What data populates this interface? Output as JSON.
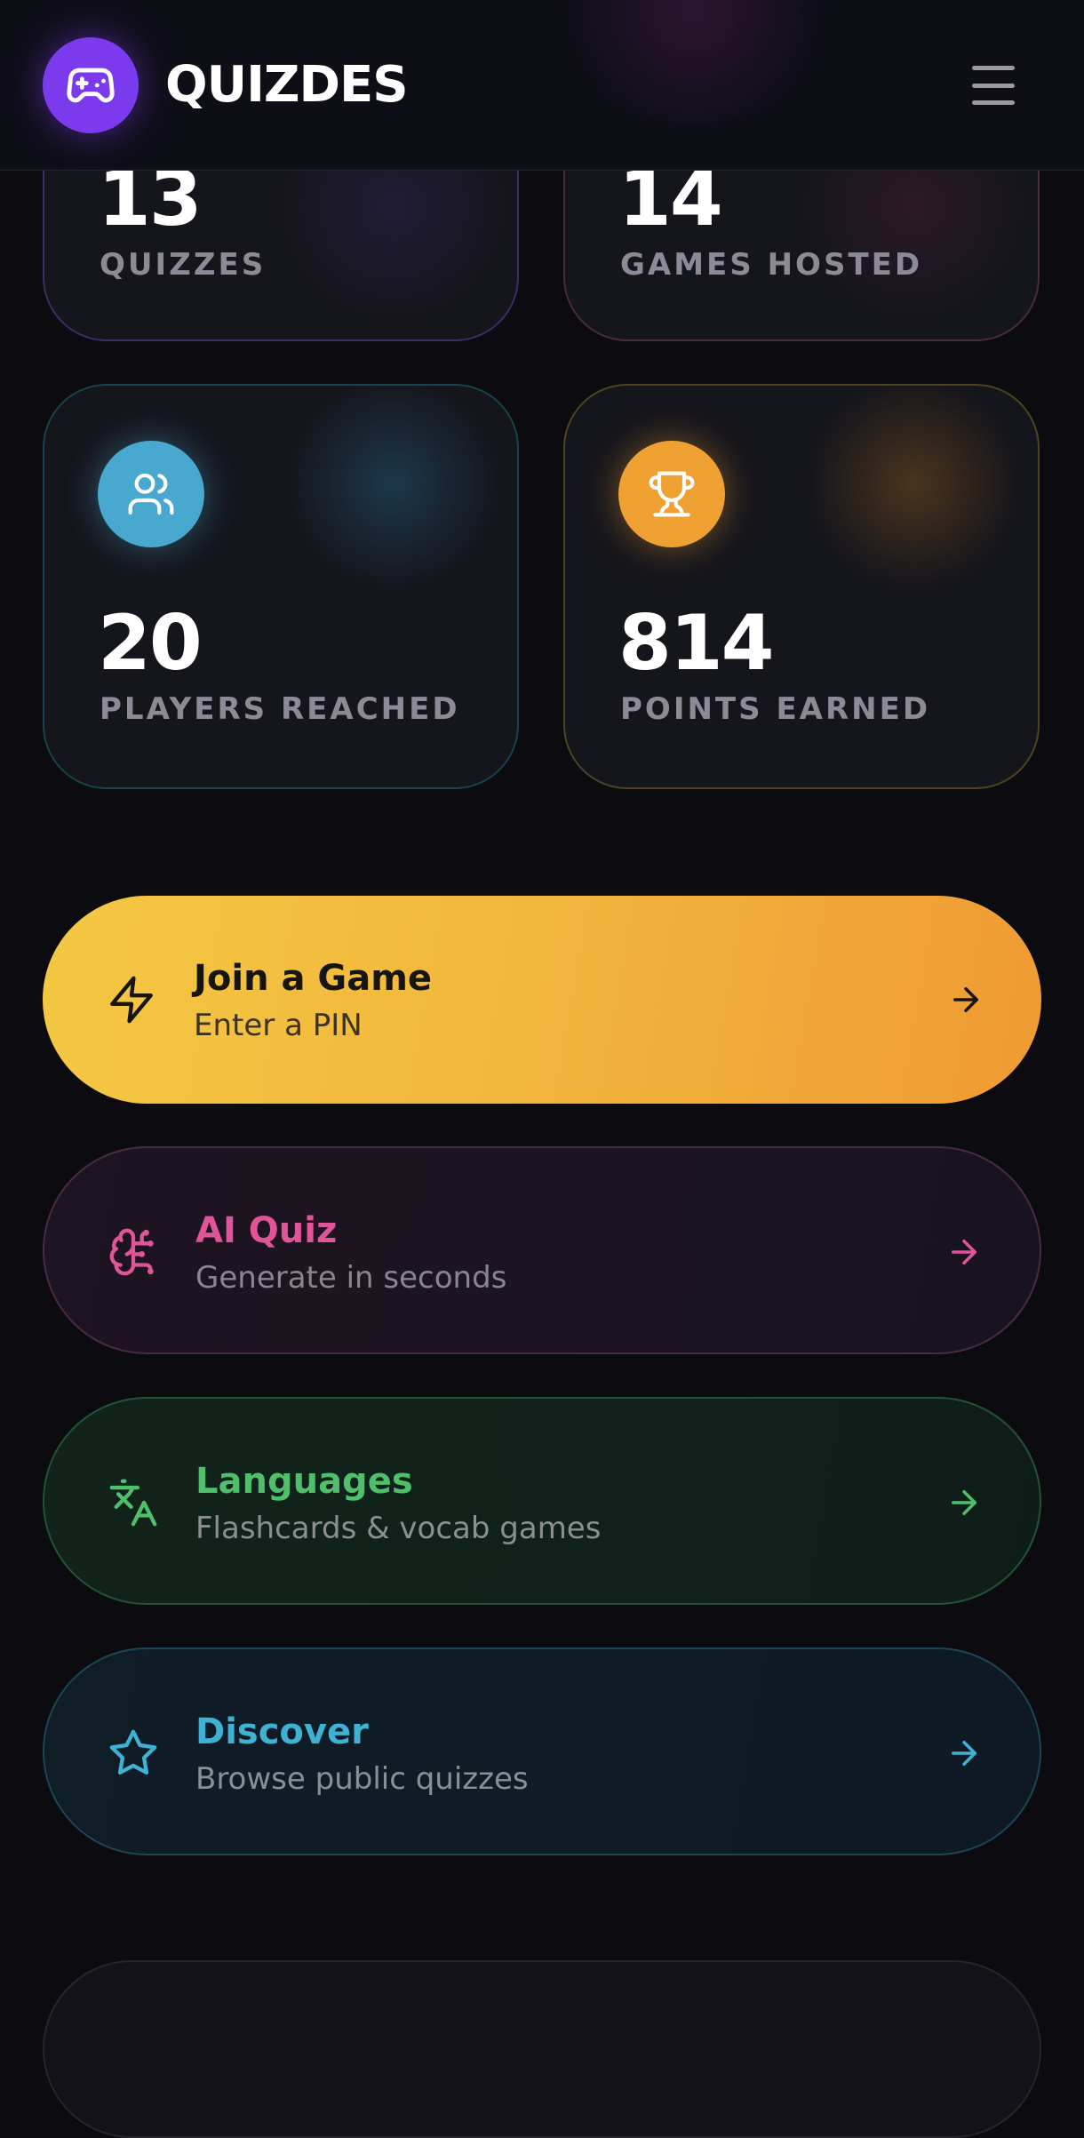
{
  "header": {
    "brand": "QUIZDES",
    "logo_icon": "gamepad-icon",
    "menu_icon": "hamburger-menu-icon",
    "accent": "#7c3aed"
  },
  "stats": [
    {
      "id": "quizzes",
      "value": "13",
      "label": "QUIZZES"
    },
    {
      "id": "games_hosted",
      "value": "14",
      "label": "GAMES HOSTED"
    },
    {
      "id": "players_reached",
      "value": "20",
      "label": "PLAYERS REACHED",
      "icon": "users-icon",
      "color": "#49a8cf"
    },
    {
      "id": "points_earned",
      "value": "814",
      "label": "POINTS EARNED",
      "icon": "trophy-icon",
      "color": "#efa131"
    }
  ],
  "actions": [
    {
      "id": "join",
      "title": "Join a Game",
      "subtitle": "Enter a PIN",
      "icon": "lightning-icon",
      "color": "#f2b53c"
    },
    {
      "id": "ai_quiz",
      "title": "AI Quiz",
      "subtitle": "Generate in seconds",
      "icon": "brain-icon",
      "color": "#e0559a"
    },
    {
      "id": "languages",
      "title": "Languages",
      "subtitle": "Flashcards & vocab games",
      "icon": "translate-icon",
      "color": "#4fbf6c"
    },
    {
      "id": "discover",
      "title": "Discover",
      "subtitle": "Browse public quizzes",
      "icon": "star-icon",
      "color": "#3fb1d3"
    }
  ]
}
